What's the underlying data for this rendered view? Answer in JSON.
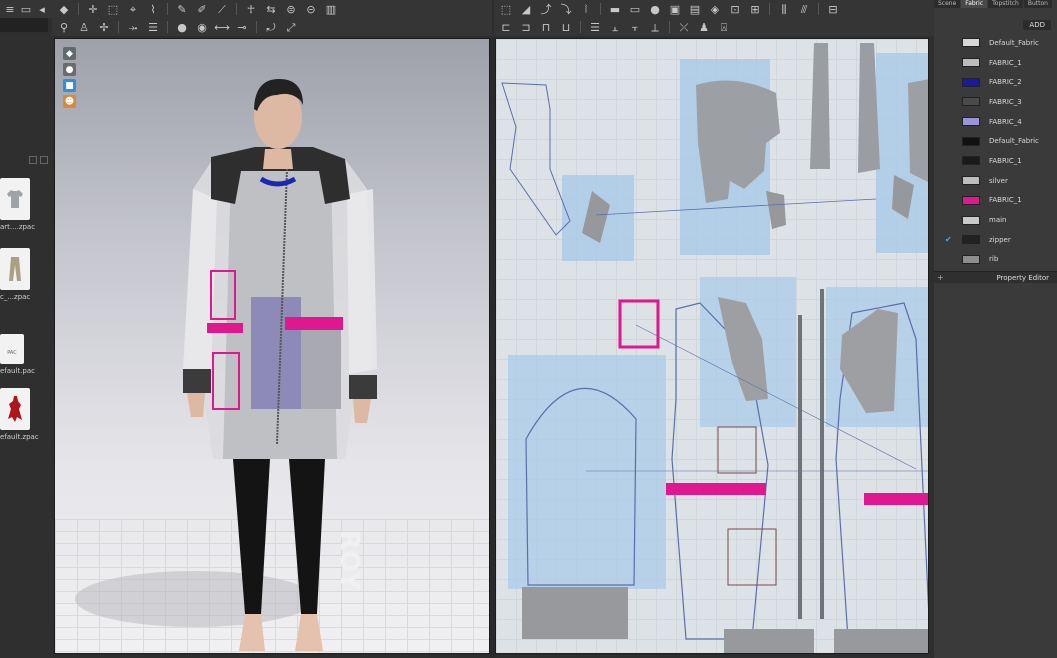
{
  "library": {
    "items": [
      {
        "label": "art....zpac",
        "icon": "shirt-icon"
      },
      {
        "label": "c_...zpac",
        "icon": "pants-icon"
      },
      {
        "label": "efault.pac",
        "icon": "pac-file-icon",
        "file_text": "PAC"
      },
      {
        "label": "efault.zpac",
        "icon": "avatar-icon"
      }
    ]
  },
  "right_panel": {
    "tabs": [
      "Scene",
      "Fabric",
      "Topstitch",
      "Button"
    ],
    "active_tab": "Fabric",
    "add_label": "ADD",
    "fabrics": [
      {
        "name": "Default_Fabric",
        "color": "#d8d8d8"
      },
      {
        "name": "FABRIC_1",
        "color": "#bcbcbc"
      },
      {
        "name": "FABRIC_2",
        "color": "#1a1aa0"
      },
      {
        "name": "FABRIC_3",
        "color": "#4a4a4a"
      },
      {
        "name": "FABRIC_4",
        "color": "#9a95d8"
      },
      {
        "name": "Default_Fabric",
        "color": "#111111"
      },
      {
        "name": "FABRIC_1",
        "color": "#1a1a1a"
      },
      {
        "name": "silver",
        "color": "#bdbdbd"
      },
      {
        "name": "FABRIC_1",
        "color": "#e0188f"
      },
      {
        "name": "main",
        "color": "#c9c9c9"
      },
      {
        "name": "zipper",
        "color": "#222222",
        "checked": true
      },
      {
        "name": "rib",
        "color": "#8d8d8d"
      }
    ],
    "property_editor_label": "Property Editor"
  },
  "colors": {
    "accent_magenta": "#e0188f",
    "pattern_highlight": "#a9cbe8",
    "outline": "#5a6fa8"
  }
}
